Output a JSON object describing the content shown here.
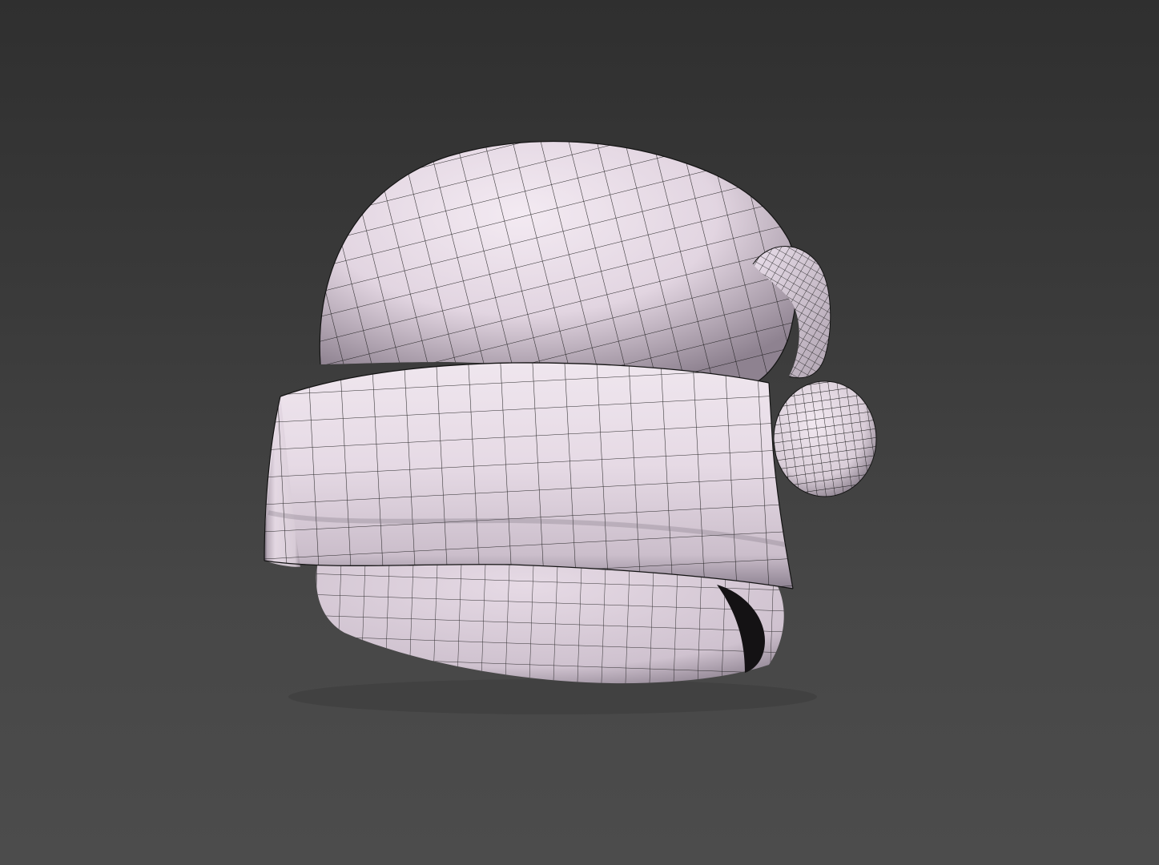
{
  "viewport": {
    "background_top": "#2f2f2f",
    "background_bottom": "#4c4c4c"
  },
  "model": {
    "subject": "hat-mesh",
    "surface_color": "#e7dbe6",
    "shadow_color": "#6e6470",
    "wire_color": "#141414",
    "display_mode": "shaded-with-wireframe"
  }
}
